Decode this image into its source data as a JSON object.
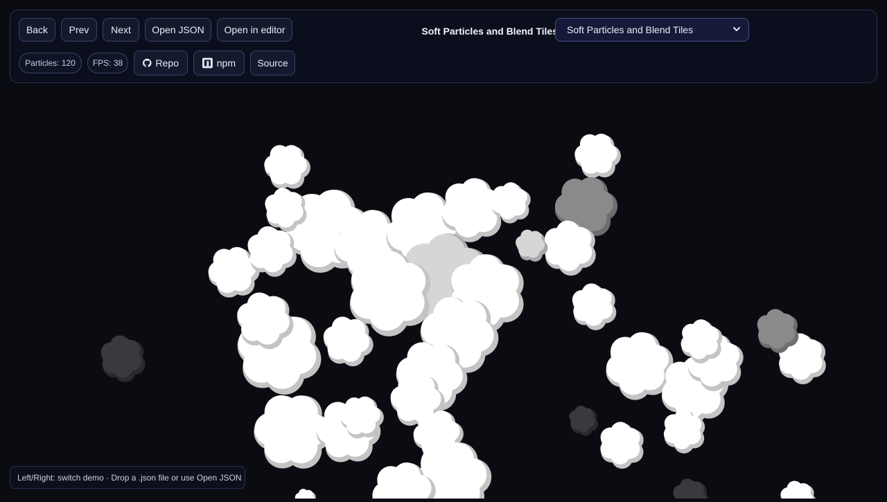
{
  "toolbar": {
    "back_label": "Back",
    "prev_label": "Prev",
    "next_label": "Next",
    "open_json_label": "Open JSON",
    "open_editor_label": "Open in editor",
    "particles_label": "Particles: 120",
    "fps_label": "FPS: 38",
    "repo_label": "Repo",
    "npm_label": "npm",
    "source_label": "Source",
    "repo_icon": "github-icon",
    "npm_icon": "npm-icon"
  },
  "demo": {
    "label": "Soft Particles and Blend Tiles",
    "selected": "Soft Particles and Blend Tiles"
  },
  "hint": {
    "text": "Left/Right: switch demo · Drop a .json file or use Open JSON"
  },
  "colors": {
    "background": "#0b0c12",
    "panel": "#0b0e1c",
    "panel_border": "#2a3150",
    "button": "#141a2e",
    "button_border": "#39426a",
    "particle_light": "#ffffff",
    "particle_mid": "#d6d6d6",
    "particle_dim": "#8a8a8a",
    "particle_dark": "#3a3a3e"
  }
}
